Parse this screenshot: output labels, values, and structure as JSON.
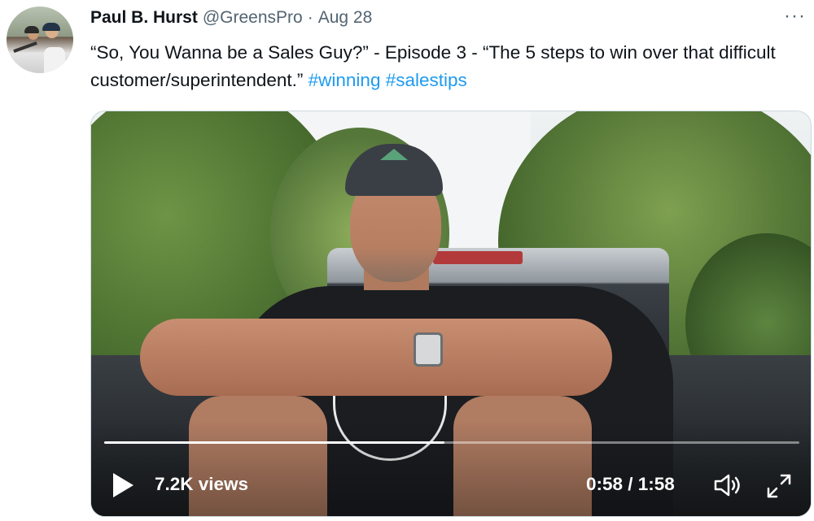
{
  "tweet": {
    "author_name": "Paul B. Hurst",
    "author_handle": "@GreensPro",
    "separator": "·",
    "date": "Aug 28",
    "more_icon": "more-horizontal-icon",
    "more_label": "···",
    "text_main": "“So, You Wanna be a Sales Guy?” - Episode 3 - “The 5 steps to win over that difficult customer/superintendent.” ",
    "hashtags": [
      "#winning",
      "#salestips"
    ]
  },
  "video": {
    "views": "7.2K views",
    "time": "0:58 / 1:58",
    "progress": 0.49,
    "play_icon": "play-icon",
    "volume_icon": "volume-icon",
    "fullscreen_icon": "fullscreen-icon",
    "colors": {
      "control_text": "#ffffff",
      "progress_fill": "#ffffff"
    }
  },
  "colors": {
    "hashtag": "#1d9bf0",
    "secondary_text": "#536471",
    "primary_text": "#0f1419"
  }
}
